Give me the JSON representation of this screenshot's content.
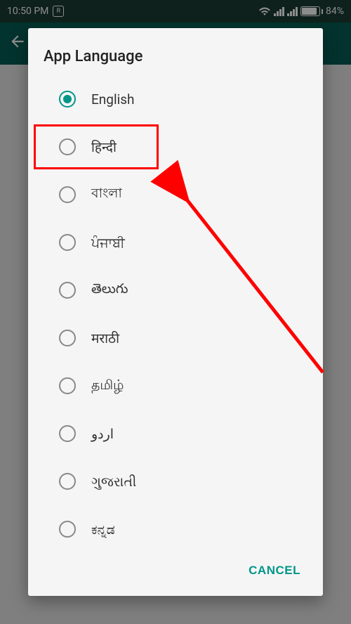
{
  "status": {
    "time": "10:50 PM",
    "battery_pct": "84%"
  },
  "dialog": {
    "title": "App Language",
    "cancel": "CANCEL"
  },
  "languages": [
    {
      "label": "English",
      "selected": true
    },
    {
      "label": "हिन्दी",
      "selected": false
    },
    {
      "label": "বাংলা",
      "selected": false
    },
    {
      "label": "ਪੰਜਾਬੀ",
      "selected": false
    },
    {
      "label": "తెలుగు",
      "selected": false
    },
    {
      "label": "मराठी",
      "selected": false
    },
    {
      "label": "தமிழ்",
      "selected": false
    },
    {
      "label": "اردو",
      "selected": false
    },
    {
      "label": "ગુજરાતી",
      "selected": false
    },
    {
      "label": "ಕನ್ನಡ",
      "selected": false
    }
  ],
  "annotation": {
    "highlight_index": 1
  }
}
